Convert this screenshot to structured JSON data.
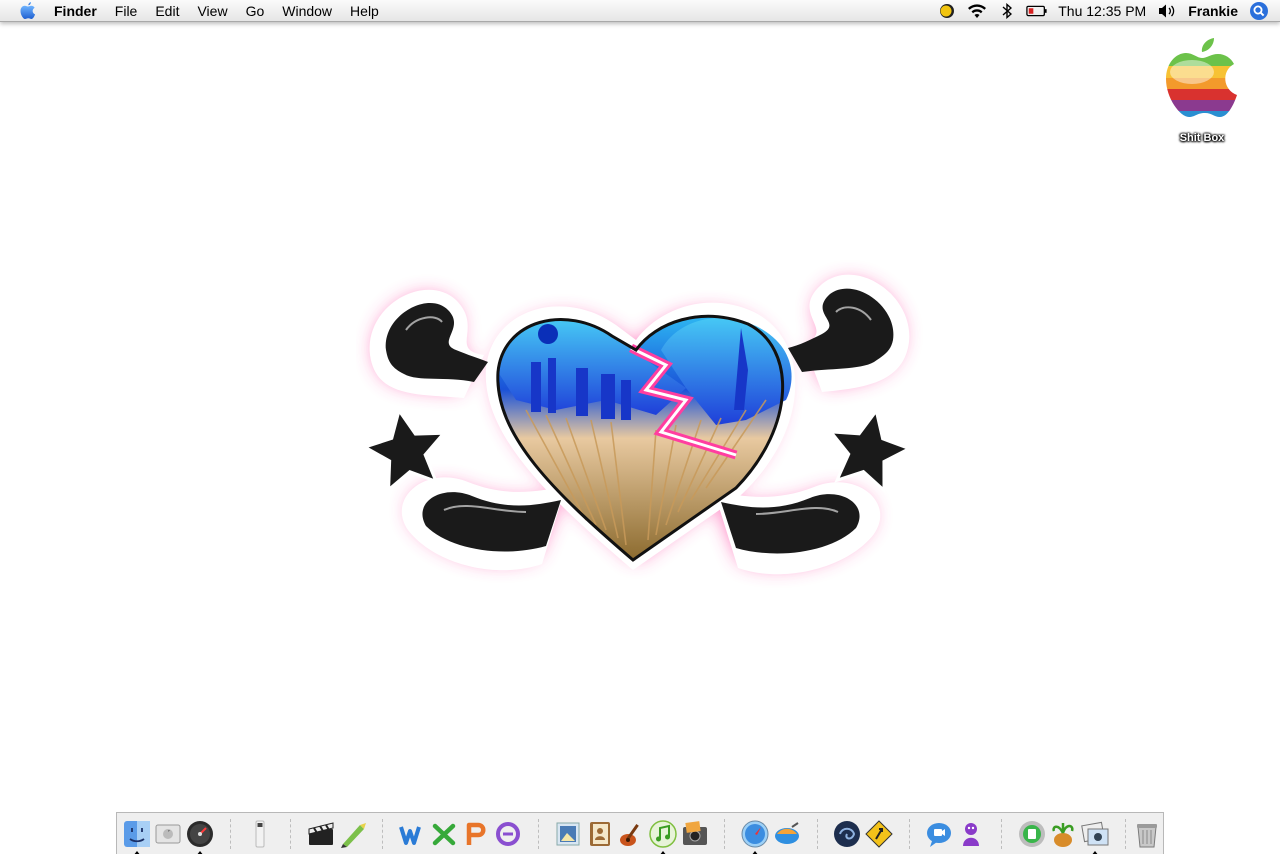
{
  "menubar": {
    "app_name": "Finder",
    "items": [
      "File",
      "Edit",
      "View",
      "Go",
      "Window",
      "Help"
    ],
    "status": {
      "clock": "Thu 12:35 PM",
      "user": "Frankie",
      "icons": [
        "updates-icon",
        "wifi-icon",
        "bluetooth-icon",
        "battery-icon",
        "volume-icon",
        "spotlight-icon"
      ]
    }
  },
  "desktop": {
    "drive_label": "Shit Box",
    "wallpaper": "broken-heart-crossbones"
  },
  "dock": {
    "items": [
      {
        "name": "finder",
        "running": true
      },
      {
        "name": "preferences-drive",
        "running": false
      },
      {
        "name": "dashboard",
        "running": true
      },
      {
        "name": "ipod",
        "running": false
      },
      {
        "name": "final-cut",
        "running": false
      },
      {
        "name": "sketch",
        "running": false
      },
      {
        "name": "word",
        "running": false
      },
      {
        "name": "excel",
        "running": false
      },
      {
        "name": "powerpoint",
        "running": false
      },
      {
        "name": "entourage",
        "running": false
      },
      {
        "name": "preview",
        "running": false
      },
      {
        "name": "address-book",
        "running": false
      },
      {
        "name": "garageband",
        "running": false
      },
      {
        "name": "itunes",
        "running": true
      },
      {
        "name": "iphoto",
        "running": false
      },
      {
        "name": "safari",
        "running": true
      },
      {
        "name": "transmit",
        "running": false
      },
      {
        "name": "quicksilver",
        "running": false
      },
      {
        "name": "coconut-battery",
        "running": false
      },
      {
        "name": "ichat",
        "running": false
      },
      {
        "name": "adium",
        "running": false
      },
      {
        "name": "garage-app",
        "running": false
      },
      {
        "name": "tropical-app",
        "running": false
      },
      {
        "name": "photo-app",
        "running": true
      },
      {
        "name": "trash",
        "running": false
      }
    ]
  }
}
